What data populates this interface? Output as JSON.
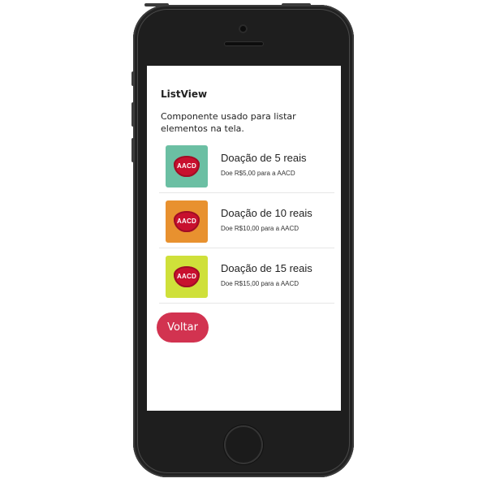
{
  "screen": {
    "title": "ListView",
    "description": "Componente usado para listar elementos na tela."
  },
  "list": {
    "items": [
      {
        "title": "Doação de 5 reais",
        "subtitle": "Doe R$5,00 para a AACD",
        "logo_text": "AACD",
        "tile_color": "#6bbfa3"
      },
      {
        "title": "Doação de 10 reais",
        "subtitle": "Doe R$10,00 para a AACD",
        "logo_text": "AACD",
        "tile_color": "#e8912f"
      },
      {
        "title": "Doação de 15 reais",
        "subtitle": "Doe R$15,00 para a AACD",
        "logo_text": "AACD",
        "tile_color": "#cfe03a"
      }
    ]
  },
  "buttons": {
    "back_label": "Voltar",
    "back_color": "#d23350"
  },
  "colors": {
    "logo_red": "#c8102e",
    "phone_body": "#1e1e1e"
  }
}
